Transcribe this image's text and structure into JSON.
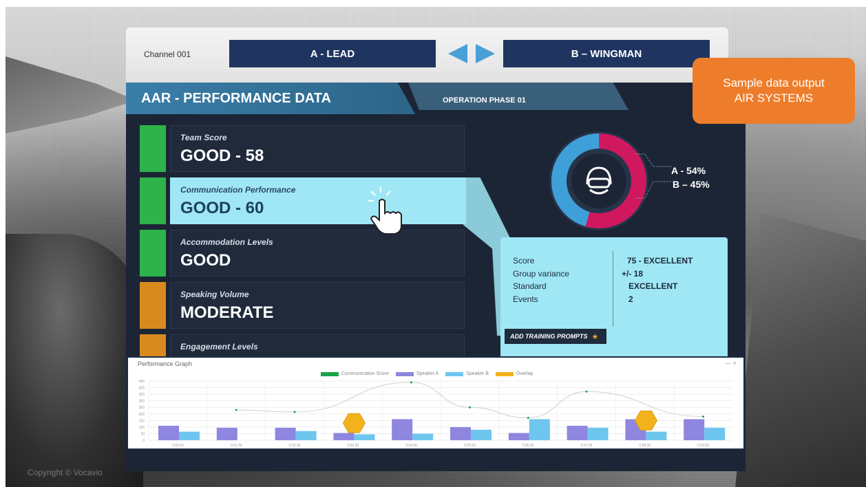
{
  "header": {
    "channel": "Channel 001",
    "lead": "A - LEAD",
    "wingman": "B – WINGMAN"
  },
  "panel": {
    "title": "AAR - PERFORMANCE DATA",
    "phase": "OPERATION PHASE 01"
  },
  "cards": [
    {
      "label": "Team Score",
      "value": "GOOD - 58",
      "status_color": "#2eb24a"
    },
    {
      "label": "Communication Performance",
      "value": "GOOD - 60",
      "status_color": "#2eb24a"
    },
    {
      "label": "Accommodation Levels",
      "value": "GOOD",
      "status_color": "#2eb24a"
    },
    {
      "label": "Speaking Volume",
      "value": "MODERATE",
      "status_color": "#d98a1f"
    },
    {
      "label": "Engagement Levels",
      "value": "",
      "status_color": "#d98a1f"
    }
  ],
  "donut": {
    "a_label": "A - 54%",
    "b_label": "B – 45%",
    "a_value": 54,
    "b_value": 45,
    "a_color": "#d0185f",
    "b_color": "#3f9fd8",
    "icon": "pilot-helmet-icon"
  },
  "details": {
    "score_label": "Score",
    "score_value": "75 - EXCELLENT",
    "variance_label": "Group variance",
    "variance_value": "+/- 18",
    "standard_label": "Standard",
    "standard_value": "EXCELLENT",
    "events_label": "Events",
    "events_value": "2",
    "training_button": "ADD TRAINING PROMPTS"
  },
  "callout": {
    "line1": "Sample data output",
    "line2": "AIR SYSTEMS"
  },
  "copyright": "Copyright © Vocavio",
  "graph": {
    "title": "Performance Graph",
    "controls": "—  ×",
    "legend": [
      {
        "name": "Communication Score",
        "color": "#1aa34a"
      },
      {
        "name": "Speaker A",
        "color": "#8f86e0"
      },
      {
        "name": "Speaker B",
        "color": "#6ec6ee"
      },
      {
        "name": "Overlap",
        "color": "#f2b21c"
      }
    ]
  },
  "chart_data": {
    "type": "bar",
    "categories": [
      "0:00:30",
      "0:01:30",
      "0:02:30",
      "0:03:30",
      "0:04:30",
      "0:05:30",
      "0:06:30",
      "0:07:30",
      "0:08:30",
      "0:09:30"
    ],
    "ylim": [
      0,
      450
    ],
    "yticks": [
      0,
      50,
      100,
      150,
      200,
      250,
      300,
      350,
      400,
      450
    ],
    "series": [
      {
        "name": "Speaker A",
        "values": [
          110,
          95,
          95,
          55,
          160,
          100,
          55,
          110,
          160,
          160
        ]
      },
      {
        "name": "Speaker B",
        "values": [
          65,
          0,
          70,
          45,
          50,
          80,
          160,
          95,
          65,
          95
        ]
      },
      {
        "name": "Communication Score",
        "values": [
          null,
          230,
          215,
          null,
          440,
          250,
          170,
          370,
          null,
          180
        ]
      },
      {
        "name": "Overlap",
        "values": [
          0,
          0,
          0,
          130,
          0,
          0,
          0,
          0,
          150,
          0
        ]
      }
    ]
  }
}
